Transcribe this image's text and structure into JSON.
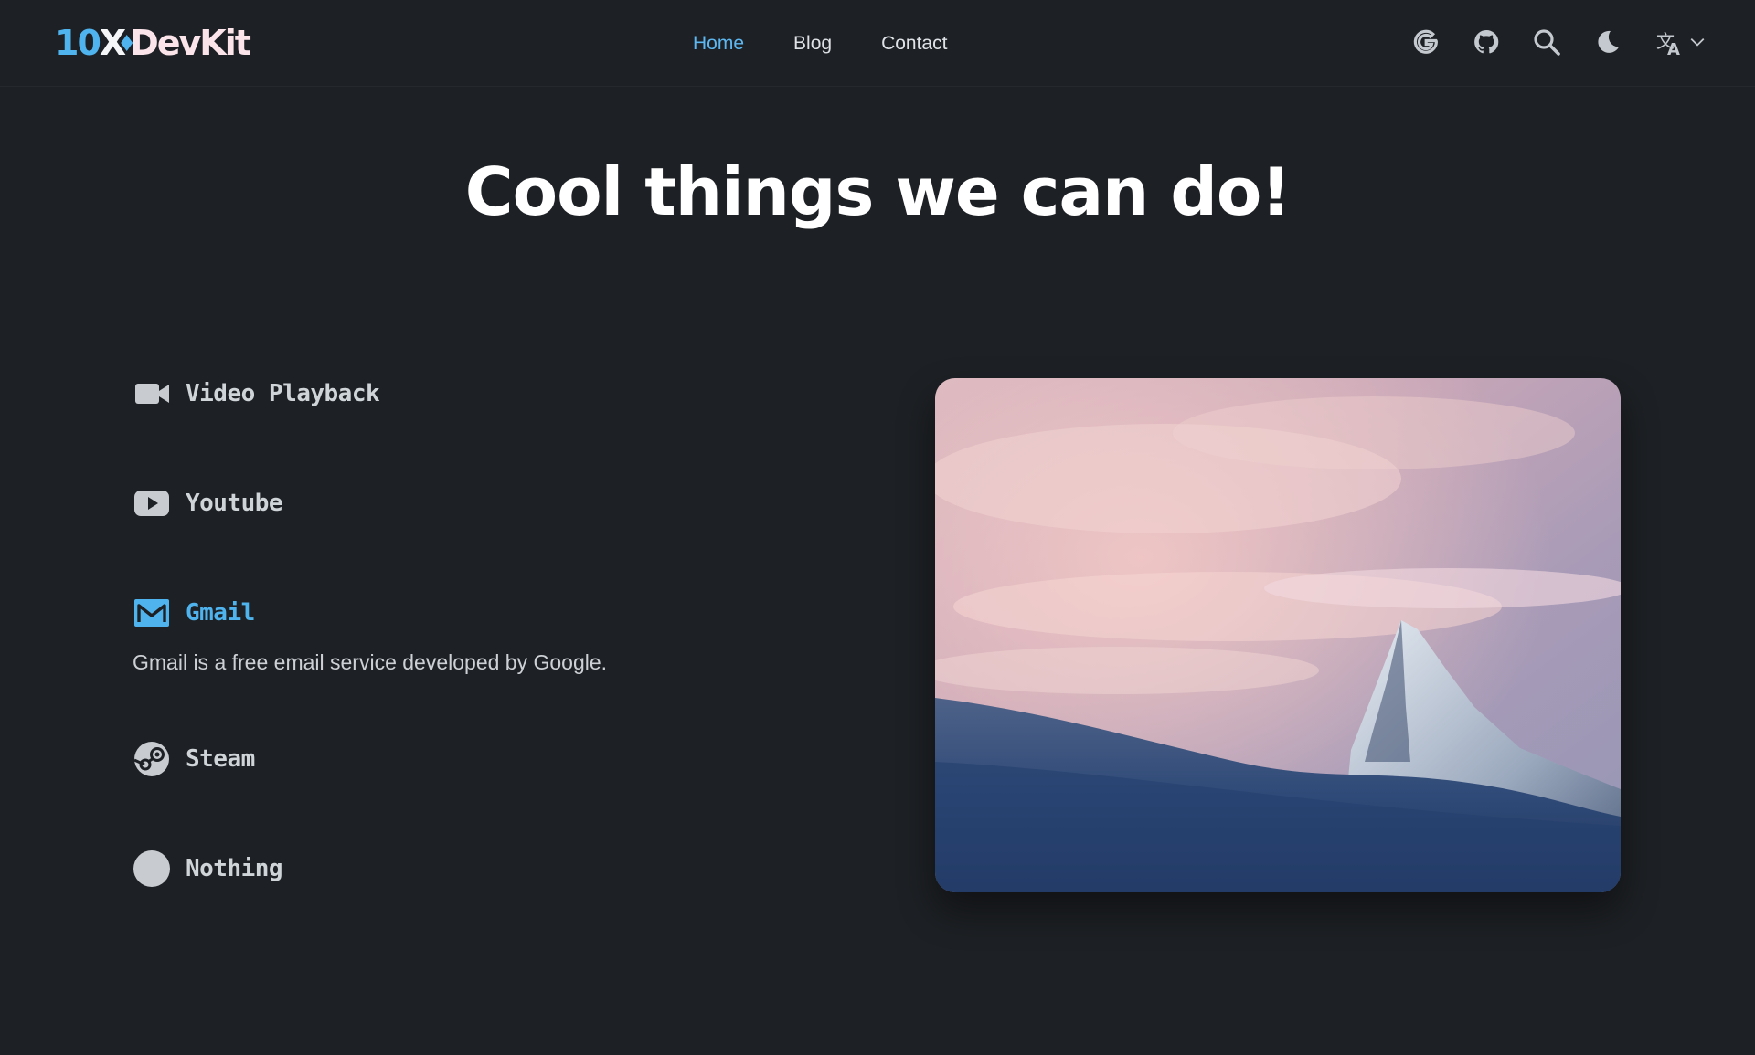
{
  "brand": {
    "part1": "10",
    "part2": "X",
    "part3": "DevKit"
  },
  "nav": {
    "items": [
      {
        "label": "Home",
        "active": true
      },
      {
        "label": "Blog",
        "active": false
      },
      {
        "label": "Contact",
        "active": false
      }
    ]
  },
  "toolbar": {
    "icons": [
      "google-icon",
      "github-icon",
      "search-icon",
      "moon-icon",
      "translate-icon"
    ]
  },
  "hero": {
    "title": "Cool things we can do!"
  },
  "features": [
    {
      "label": "Video Playback",
      "icon": "video-camera-icon",
      "active": false
    },
    {
      "label": "Youtube",
      "icon": "youtube-icon",
      "active": false
    },
    {
      "label": "Gmail",
      "icon": "gmail-icon",
      "active": true,
      "description": "Gmail is a free email service developed by Google."
    },
    {
      "label": "Steam",
      "icon": "steam-icon",
      "active": false
    },
    {
      "label": "Nothing",
      "icon": "circle-icon",
      "active": false
    }
  ],
  "colors": {
    "accent": "#4fb3ee",
    "background": "#1d2024",
    "text": "#cfd4d9"
  }
}
